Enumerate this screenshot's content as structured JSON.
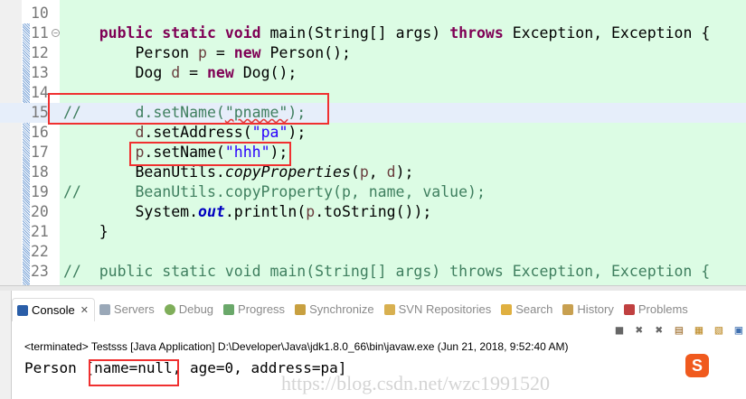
{
  "editor": {
    "lines": [
      {
        "n": "10"
      },
      {
        "n": "11"
      },
      {
        "n": "12"
      },
      {
        "n": "13"
      },
      {
        "n": "14"
      },
      {
        "n": "15"
      },
      {
        "n": "16"
      },
      {
        "n": "17"
      },
      {
        "n": "18"
      },
      {
        "n": "19"
      },
      {
        "n": "20"
      },
      {
        "n": "21"
      },
      {
        "n": "22"
      },
      {
        "n": "23"
      }
    ],
    "code": {
      "l11": [
        "public static void",
        " main(String[] args) ",
        "throws",
        " Exception, Exception {"
      ],
      "l12": [
        "Person ",
        "p",
        " = ",
        "new",
        " Person();"
      ],
      "l13": [
        "Dog ",
        "d",
        " = ",
        "new",
        " Dog();"
      ],
      "l15": [
        "//      d.setName(",
        "\"pname\"",
        ");"
      ],
      "l16": [
        "d",
        ".setAddress(",
        "\"pa\"",
        ");"
      ],
      "l17": [
        "p",
        ".setName(",
        "\"hhh\"",
        ");"
      ],
      "l18": [
        "BeanUtils.",
        "copyProperties",
        "(",
        "p",
        ", ",
        "d",
        ");"
      ],
      "l19": "//      BeanUtils.copyProperty(p, name, value);",
      "l20": [
        "System.",
        "out",
        ".println(",
        "p",
        ".toString());"
      ],
      "l21": "}",
      "l23": "//  public static void main(String[] args) throws Exception, Exception {"
    }
  },
  "console": {
    "tabs": [
      {
        "label": "Console",
        "color": "#2a5ea8"
      },
      {
        "label": "Servers",
        "color": "#9aa8b8"
      },
      {
        "label": "Debug",
        "color": "#7fae5a"
      },
      {
        "label": "Progress",
        "color": "#6aa86a"
      },
      {
        "label": "Synchronize",
        "color": "#c8a040"
      },
      {
        "label": "SVN Repositories",
        "color": "#d8b050"
      },
      {
        "label": "Search",
        "color": "#e0b040"
      },
      {
        "label": "History",
        "color": "#c8a050"
      },
      {
        "label": "Problems",
        "color": "#c04040"
      }
    ],
    "status": "<terminated> Testsss [Java Application] D:\\Developer\\Java\\jdk1.8.0_66\\bin\\javaw.exe (Jun 21, 2018, 9:52:40 AM)",
    "output": "Person [name=null, age=0, address=pa]",
    "watermark": "https://blog.csdn.net/wzc1991520",
    "ime_logo": "S"
  }
}
